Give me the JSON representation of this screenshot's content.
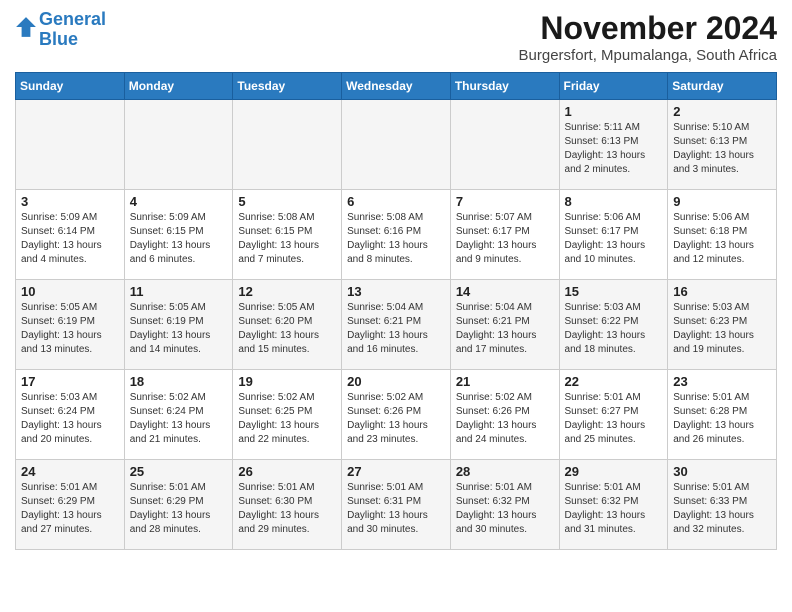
{
  "header": {
    "logo_line1": "General",
    "logo_line2": "Blue",
    "month_title": "November 2024",
    "location": "Burgersfort, Mpumalanga, South Africa"
  },
  "weekdays": [
    "Sunday",
    "Monday",
    "Tuesday",
    "Wednesday",
    "Thursday",
    "Friday",
    "Saturday"
  ],
  "weeks": [
    [
      {
        "day": "",
        "info": ""
      },
      {
        "day": "",
        "info": ""
      },
      {
        "day": "",
        "info": ""
      },
      {
        "day": "",
        "info": ""
      },
      {
        "day": "",
        "info": ""
      },
      {
        "day": "1",
        "info": "Sunrise: 5:11 AM\nSunset: 6:13 PM\nDaylight: 13 hours\nand 2 minutes."
      },
      {
        "day": "2",
        "info": "Sunrise: 5:10 AM\nSunset: 6:13 PM\nDaylight: 13 hours\nand 3 minutes."
      }
    ],
    [
      {
        "day": "3",
        "info": "Sunrise: 5:09 AM\nSunset: 6:14 PM\nDaylight: 13 hours\nand 4 minutes."
      },
      {
        "day": "4",
        "info": "Sunrise: 5:09 AM\nSunset: 6:15 PM\nDaylight: 13 hours\nand 6 minutes."
      },
      {
        "day": "5",
        "info": "Sunrise: 5:08 AM\nSunset: 6:15 PM\nDaylight: 13 hours\nand 7 minutes."
      },
      {
        "day": "6",
        "info": "Sunrise: 5:08 AM\nSunset: 6:16 PM\nDaylight: 13 hours\nand 8 minutes."
      },
      {
        "day": "7",
        "info": "Sunrise: 5:07 AM\nSunset: 6:17 PM\nDaylight: 13 hours\nand 9 minutes."
      },
      {
        "day": "8",
        "info": "Sunrise: 5:06 AM\nSunset: 6:17 PM\nDaylight: 13 hours\nand 10 minutes."
      },
      {
        "day": "9",
        "info": "Sunrise: 5:06 AM\nSunset: 6:18 PM\nDaylight: 13 hours\nand 12 minutes."
      }
    ],
    [
      {
        "day": "10",
        "info": "Sunrise: 5:05 AM\nSunset: 6:19 PM\nDaylight: 13 hours\nand 13 minutes."
      },
      {
        "day": "11",
        "info": "Sunrise: 5:05 AM\nSunset: 6:19 PM\nDaylight: 13 hours\nand 14 minutes."
      },
      {
        "day": "12",
        "info": "Sunrise: 5:05 AM\nSunset: 6:20 PM\nDaylight: 13 hours\nand 15 minutes."
      },
      {
        "day": "13",
        "info": "Sunrise: 5:04 AM\nSunset: 6:21 PM\nDaylight: 13 hours\nand 16 minutes."
      },
      {
        "day": "14",
        "info": "Sunrise: 5:04 AM\nSunset: 6:21 PM\nDaylight: 13 hours\nand 17 minutes."
      },
      {
        "day": "15",
        "info": "Sunrise: 5:03 AM\nSunset: 6:22 PM\nDaylight: 13 hours\nand 18 minutes."
      },
      {
        "day": "16",
        "info": "Sunrise: 5:03 AM\nSunset: 6:23 PM\nDaylight: 13 hours\nand 19 minutes."
      }
    ],
    [
      {
        "day": "17",
        "info": "Sunrise: 5:03 AM\nSunset: 6:24 PM\nDaylight: 13 hours\nand 20 minutes."
      },
      {
        "day": "18",
        "info": "Sunrise: 5:02 AM\nSunset: 6:24 PM\nDaylight: 13 hours\nand 21 minutes."
      },
      {
        "day": "19",
        "info": "Sunrise: 5:02 AM\nSunset: 6:25 PM\nDaylight: 13 hours\nand 22 minutes."
      },
      {
        "day": "20",
        "info": "Sunrise: 5:02 AM\nSunset: 6:26 PM\nDaylight: 13 hours\nand 23 minutes."
      },
      {
        "day": "21",
        "info": "Sunrise: 5:02 AM\nSunset: 6:26 PM\nDaylight: 13 hours\nand 24 minutes."
      },
      {
        "day": "22",
        "info": "Sunrise: 5:01 AM\nSunset: 6:27 PM\nDaylight: 13 hours\nand 25 minutes."
      },
      {
        "day": "23",
        "info": "Sunrise: 5:01 AM\nSunset: 6:28 PM\nDaylight: 13 hours\nand 26 minutes."
      }
    ],
    [
      {
        "day": "24",
        "info": "Sunrise: 5:01 AM\nSunset: 6:29 PM\nDaylight: 13 hours\nand 27 minutes."
      },
      {
        "day": "25",
        "info": "Sunrise: 5:01 AM\nSunset: 6:29 PM\nDaylight: 13 hours\nand 28 minutes."
      },
      {
        "day": "26",
        "info": "Sunrise: 5:01 AM\nSunset: 6:30 PM\nDaylight: 13 hours\nand 29 minutes."
      },
      {
        "day": "27",
        "info": "Sunrise: 5:01 AM\nSunset: 6:31 PM\nDaylight: 13 hours\nand 30 minutes."
      },
      {
        "day": "28",
        "info": "Sunrise: 5:01 AM\nSunset: 6:32 PM\nDaylight: 13 hours\nand 30 minutes."
      },
      {
        "day": "29",
        "info": "Sunrise: 5:01 AM\nSunset: 6:32 PM\nDaylight: 13 hours\nand 31 minutes."
      },
      {
        "day": "30",
        "info": "Sunrise: 5:01 AM\nSunset: 6:33 PM\nDaylight: 13 hours\nand 32 minutes."
      }
    ]
  ]
}
